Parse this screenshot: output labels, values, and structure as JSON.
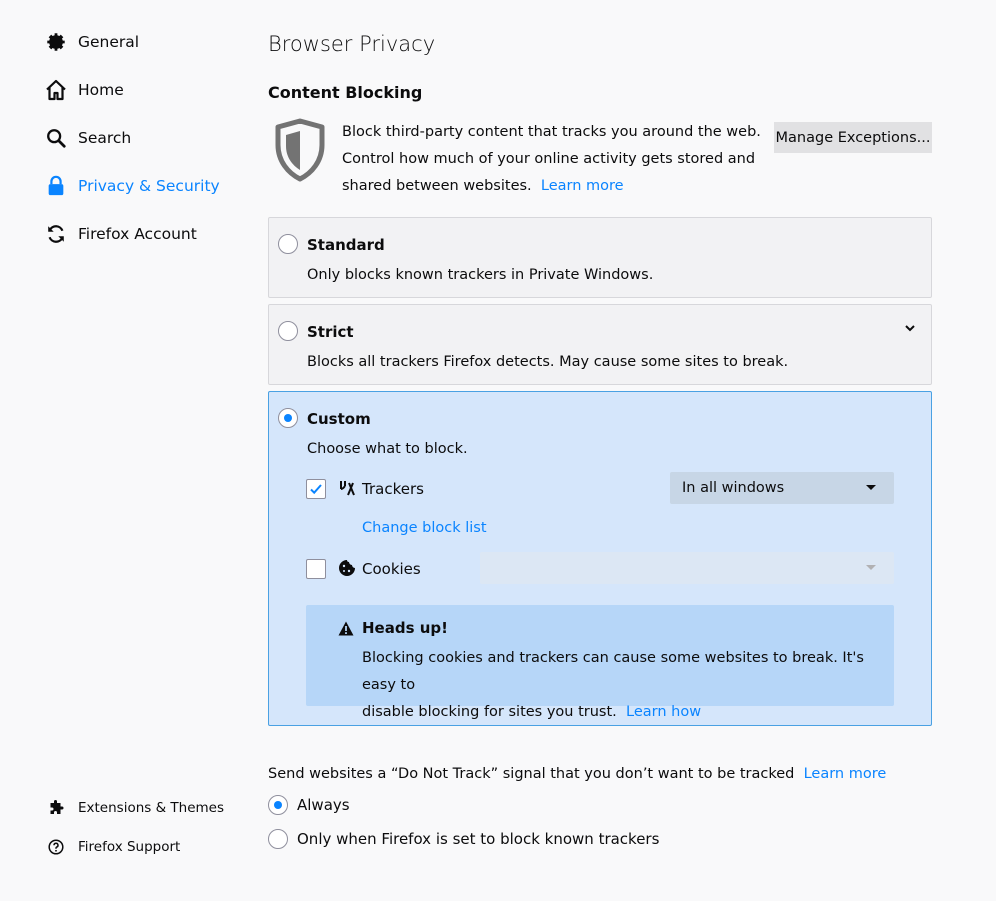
{
  "sidebar": {
    "items": [
      {
        "label": "General",
        "icon": "gear-icon"
      },
      {
        "label": "Home",
        "icon": "home-icon"
      },
      {
        "label": "Search",
        "icon": "search-icon"
      },
      {
        "label": "Privacy & Security",
        "icon": "lock-icon",
        "active": true
      },
      {
        "label": "Firefox Account",
        "icon": "sync-icon"
      }
    ],
    "footer": [
      {
        "label": "Extensions & Themes",
        "icon": "puzzle-icon"
      },
      {
        "label": "Firefox Support",
        "icon": "help-icon"
      }
    ]
  },
  "page": {
    "title": "Browser Privacy",
    "section_title": "Content Blocking",
    "description_line1": "Block third-party content that tracks you around the web.",
    "description_line2": "Control how much of your online activity gets stored and",
    "description_line3": "shared between websites.",
    "learn_more": "Learn more",
    "manage_exceptions": "Manage Exceptions..."
  },
  "options": {
    "standard": {
      "title": "Standard",
      "subtitle": "Only blocks known trackers in Private Windows.",
      "selected": false
    },
    "strict": {
      "title": "Strict",
      "subtitle": "Blocks all trackers Firefox detects. May cause some sites to break.",
      "selected": false
    },
    "custom": {
      "title": "Custom",
      "subtitle": "Choose what to block.",
      "selected": true,
      "trackers_label": "Trackers",
      "trackers_checked": true,
      "trackers_select": "In all windows",
      "change_block_list": "Change block list",
      "cookies_label": "Cookies",
      "cookies_checked": false,
      "cookies_select": "",
      "warning_title": "Heads up!",
      "warning_line1": "Blocking cookies and trackers can cause some websites to break. It's easy to",
      "warning_line2": "disable blocking for sites you trust.",
      "learn_how": "Learn how"
    }
  },
  "dnt": {
    "label": "Send websites a “Do Not Track” signal that you don’t want to be tracked",
    "learn_more": "Learn more",
    "always": "Always",
    "only_when": "Only when Firefox is set to block known trackers",
    "selected": "always"
  },
  "colors": {
    "accent": "#0a84ff",
    "selected_card": "#d5e6fb",
    "warning_bg": "#b6d6f8"
  }
}
